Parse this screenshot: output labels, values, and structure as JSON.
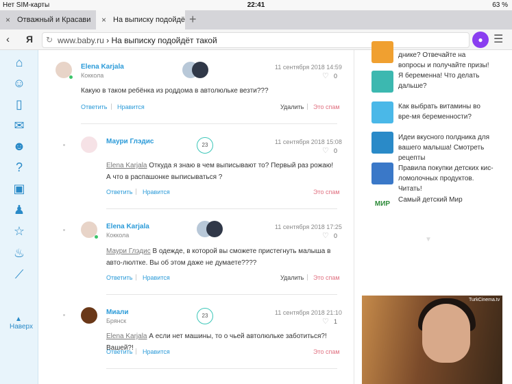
{
  "status": {
    "carrier": "Нет SIM-карты",
    "time": "22:41",
    "battery": "63 %"
  },
  "tabs": [
    {
      "label": "Отважный и Красави"
    },
    {
      "label": "На выписку подойдёт"
    }
  ],
  "address": {
    "host": "www.baby.ru",
    "sep": " › ",
    "title": "На выписку подойдёт такой"
  },
  "sidenav": {
    "label": "Наверх",
    "up": "▲"
  },
  "comments": [
    {
      "author": "Elena Karjala",
      "city": "Коккола",
      "date": "11 сентября 2018",
      "time": "14:59",
      "likes": "0",
      "text": "Какую в таком ребёнка из роддома в автолюльке везти???",
      "reply": "Ответить",
      "like": "Нравится",
      "delete": "Удалить",
      "spam": "Это спам"
    },
    {
      "author": "Маури Глэдис",
      "city": "",
      "date": "11 сентября 2018",
      "time": "15:08",
      "likes": "0",
      "badge": "23",
      "ref": "Elena Karjala",
      "text": "Откуда я знаю в чем выписывают то? Первый раз рожаю! А что в распашонке выписываться ?",
      "reply": "Ответить",
      "like": "Нравится",
      "spam": "Это спам"
    },
    {
      "author": "Elena Karjala",
      "city": "Коккола",
      "date": "11 сентября 2018",
      "time": "17:25",
      "likes": "0",
      "ref": "Маури Глэдис",
      "text": "В одежде, в которой вы сможете пристегнуть малыша в авто-люлтке. Вы об этом даже не думаете????",
      "reply": "Ответить",
      "like": "Нравится",
      "delete": "Удалить",
      "spam": "Это спам"
    },
    {
      "author": "Миали",
      "city": "Брянск",
      "date": "11 сентября 2018",
      "time": "21:10",
      "likes": "1",
      "badge": "23",
      "ref": "Elena Karjala",
      "text": "А если нет машины, то о чьей автолюльке заботиться?! Вашей?!",
      "reply": "Ответить",
      "like": "Нравится",
      "spam": "Это спам"
    }
  ],
  "right": [
    {
      "text": "днике? Отвечайте на вопросы и получайте призы!",
      "color": "#f0a030"
    },
    {
      "text": "Я беременна! Что делать дальше?",
      "color": "#3cb8b0"
    },
    {
      "text": "Как выбрать витамины во вре-мя беременности?",
      "color": "#4ab8e8"
    },
    {
      "text": "Идеи вкусного полдника для вашего малыша! Смотреть рецепты",
      "color": "#2a8ac8"
    },
    {
      "text": "Правила покупки детских кис-ломолочных продуктов. Читать!",
      "color": "#3a78c8"
    },
    {
      "text": "Самый детский Мир",
      "color": "#ffffff"
    }
  ],
  "mir_logo": "МИР",
  "video": {
    "logo": "TurkCinema.tv"
  }
}
